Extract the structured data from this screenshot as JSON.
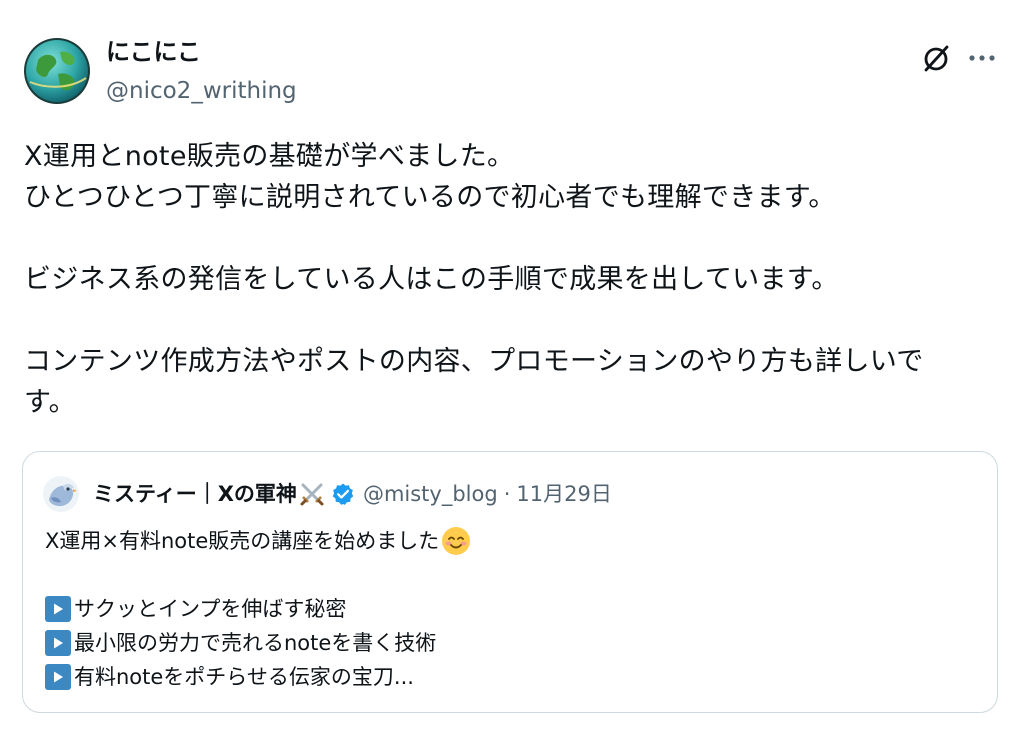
{
  "author": {
    "name": "にこにこ",
    "handle": "@nico2_writhing"
  },
  "icons": {
    "avatar": "globe-avatar",
    "grok": "grok-slash-icon",
    "more": "more-dots-icon",
    "verified": "verified-badge-icon",
    "play": "play-button-emoji",
    "swords": "crossed-swords-emoji",
    "smile": "smiling-face-emoji"
  },
  "colors": {
    "verified": "#1d9bf0",
    "secondary_text": "#536471",
    "play_box": "#3b88c3"
  },
  "tweet": {
    "lines": [
      "X運用とnote販売の基礎が学べました。",
      "ひとつひとつ丁寧に説明されているので初心者でも理解できます。",
      "",
      "ビジネス系の発信をしている人はこの手順で成果を出しています。",
      "",
      "コンテンツ作成方法やポストの内容、プロモーションのやり方も詳しいで",
      "す。"
    ]
  },
  "quote": {
    "name": "ミスティー｜Xの軍神",
    "handle": "@misty_blog",
    "separator": "·",
    "date": "11月29日",
    "text_line1": "X運用×有料note販売の講座を始めました",
    "bullets": [
      "サクッとインプを伸ばす秘密",
      "最小限の労力で売れるnoteを書く技術",
      "有料noteをポチらせる伝家の宝刀..."
    ]
  }
}
